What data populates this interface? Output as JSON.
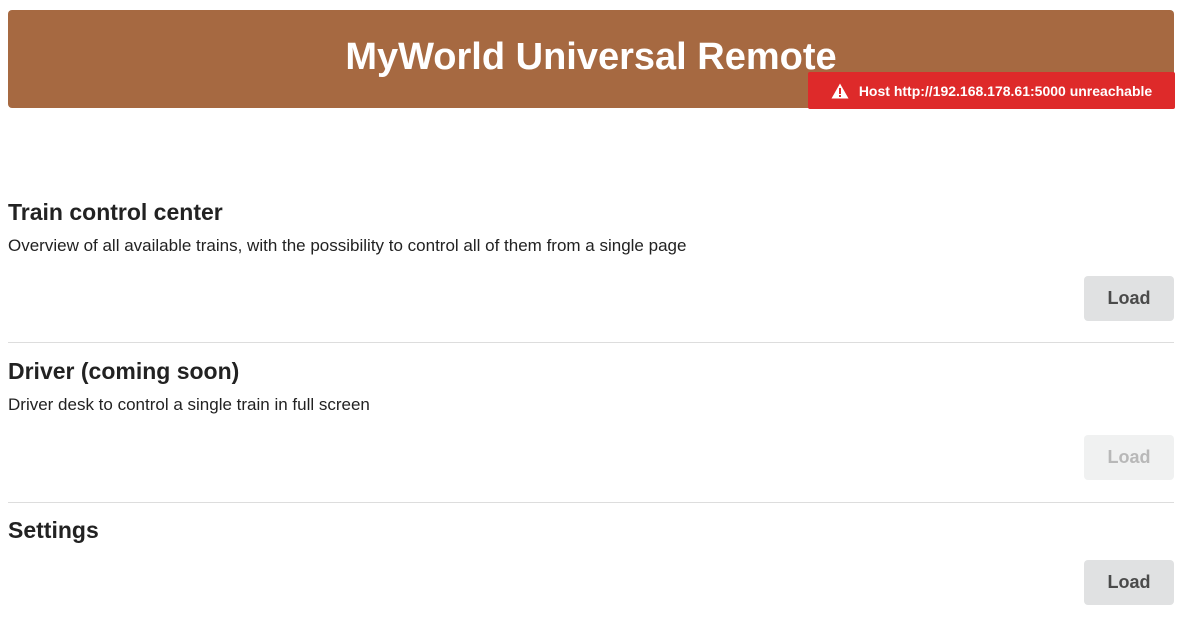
{
  "header": {
    "title": "MyWorld Universal Remote"
  },
  "error": {
    "icon": "warning-icon",
    "text": "Host http://192.168.178.61:5000 unreachable",
    "color": "#de2a2a"
  },
  "theme": {
    "header_bg": "#a66941",
    "button_bg": "#e0e1e2"
  },
  "sections": [
    {
      "title": "Train control center",
      "description": "Overview of all available trains, with the possibility to control all of them from a single page",
      "button_label": "Load",
      "enabled": true
    },
    {
      "title": "Driver (coming soon)",
      "description": "Driver desk to control a single train in full screen",
      "button_label": "Load",
      "enabled": false
    },
    {
      "title": "Settings",
      "description": "",
      "button_label": "Load",
      "enabled": true
    }
  ]
}
